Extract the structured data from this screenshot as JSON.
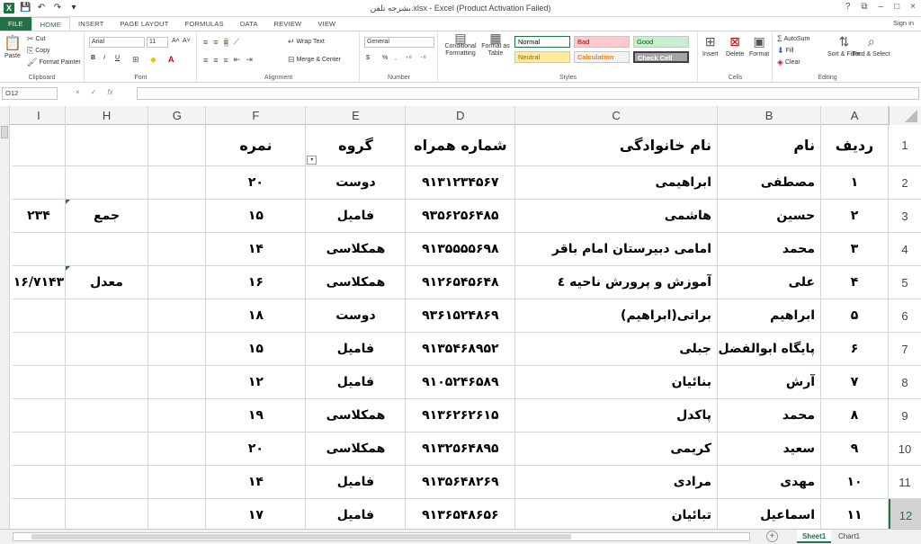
{
  "window": {
    "title": "بشرجه تلفن.xlsx - Excel (Product Activation Failed)",
    "controls": [
      "?",
      "⧉",
      "–",
      "□",
      "×"
    ]
  },
  "tabs": [
    "FILE",
    "HOME",
    "INSERT",
    "PAGE LAYOUT",
    "FORMULAS",
    "DATA",
    "REVIEW",
    "VIEW"
  ],
  "active_tab": "HOME",
  "signin": "Sign in",
  "ribbon": {
    "clipboard": {
      "label": "Clipboard",
      "paste": "Paste",
      "cut": "Cut",
      "copy": "Copy",
      "format_painter": "Format Painter"
    },
    "font": {
      "label": "Font",
      "name": "Arial",
      "size": "11",
      "bold": "B",
      "italic": "I",
      "underline": "U"
    },
    "alignment": {
      "label": "Alignment",
      "wrap_text": "Wrap Text",
      "merge_center": "Merge & Center"
    },
    "number": {
      "label": "Number",
      "format": "General",
      "currency": "$",
      "percent": "%",
      "comma": ","
    },
    "styles": {
      "label": "Styles",
      "conditional_formatting": "Conditional Formatting",
      "format_as_table": "Format as Table",
      "items": [
        {
          "name": "Normal",
          "bg": "#ffffff",
          "fg": "#000000"
        },
        {
          "name": "Bad",
          "bg": "#ffc7ce",
          "fg": "#9c0006"
        },
        {
          "name": "Good",
          "bg": "#c6efce",
          "fg": "#006100"
        },
        {
          "name": "Neutral",
          "bg": "#ffeb9c",
          "fg": "#9c6500"
        },
        {
          "name": "Calculation",
          "bg": "#f2f2f2",
          "fg": "#fa7d00"
        },
        {
          "name": "Check Cell",
          "bg": "#a5a5a5",
          "fg": "#ffffff"
        }
      ]
    },
    "cells": {
      "label": "Cells",
      "insert": "Insert",
      "delete": "Delete",
      "format": "Format"
    },
    "editing": {
      "label": "Editing",
      "autosum": "AutoSum",
      "fill": "Fill",
      "clear": "Clear",
      "sort_filter": "Sort & Filter",
      "find_select": "Find & Select"
    }
  },
  "formula_bar": {
    "name_box": "O12",
    "cancel": "×",
    "enter": "✓",
    "fx": "fx",
    "value": ""
  },
  "columns": [
    "I",
    "H",
    "G",
    "F",
    "E",
    "D",
    "C",
    "B",
    "A"
  ],
  "row_numbers": [
    "1",
    "2",
    "3",
    "4",
    "5",
    "6",
    "7",
    "8",
    "9",
    "10",
    "11",
    "12"
  ],
  "selected_row": "12",
  "table": {
    "headers": {
      "A": "ردیف",
      "B": "نام",
      "C": "نام خانوادگی",
      "D": "شماره همراه",
      "E": "گروه",
      "F": "نمره"
    },
    "rows": [
      {
        "A": "۱",
        "B": "مصطفی",
        "C": "ابراهیمی",
        "D": "۹۱۳۱۲۳۴۵۶۷",
        "E": "دوست",
        "F": "۲۰",
        "H": "",
        "I": ""
      },
      {
        "A": "۲",
        "B": "حسین",
        "C": "هاشمی",
        "D": "۹۳۵۶۲۵۶۴۸۵",
        "E": "فامیل",
        "F": "۱۵",
        "H": "جمع",
        "I": "۲۳۴"
      },
      {
        "A": "۳",
        "B": "محمد",
        "C": "امامی دبیرستان امام باقر",
        "D": "۹۱۳۵۵۵۵۶۹۸",
        "E": "همکلاسی",
        "F": "۱۴",
        "H": "",
        "I": ""
      },
      {
        "A": "۴",
        "B": "علی",
        "C": "آموزش و پرورش ناحیه ٤",
        "D": "۹۱۲۶۵۴۵۶۴۸",
        "E": "همکلاسی",
        "F": "۱۶",
        "H": "معدل",
        "I": "۱۶/۷۱۴۳"
      },
      {
        "A": "۵",
        "B": "ابراهیم",
        "C": "براتی(ابراهیم)",
        "D": "۹۳۶۱۵۲۴۸۶۹",
        "E": "دوست",
        "F": "۱۸",
        "H": "",
        "I": ""
      },
      {
        "A": "۶",
        "B": "پایگاه ابوالفضل",
        "C": "جبلی",
        "D": "۹۱۳۵۴۶۸۹۵۲",
        "E": "فامیل",
        "F": "۱۵",
        "H": "",
        "I": ""
      },
      {
        "A": "۷",
        "B": "آرش",
        "C": "بنائیان",
        "D": "۹۱۰۵۲۴۶۵۸۹",
        "E": "فامیل",
        "F": "۱۲",
        "H": "",
        "I": ""
      },
      {
        "A": "۸",
        "B": "محمد",
        "C": "پاکدل",
        "D": "۹۱۳۶۲۶۲۶۱۵",
        "E": "همکلاسی",
        "F": "۱۹",
        "H": "",
        "I": ""
      },
      {
        "A": "۹",
        "B": "سعید",
        "C": "کریمی",
        "D": "۹۱۳۲۵۶۴۸۹۵",
        "E": "همکلاسی",
        "F": "۲۰",
        "H": "",
        "I": ""
      },
      {
        "A": "۱۰",
        "B": "مهدی",
        "C": "مرادی",
        "D": "۹۱۳۵۶۴۸۲۶۹",
        "E": "فامیل",
        "F": "۱۴",
        "H": "",
        "I": ""
      },
      {
        "A": "۱۱",
        "B": "اسماعیل",
        "C": "تبائیان",
        "D": "۹۱۳۶۵۴۸۶۵۶",
        "E": "فامیل",
        "F": "۱۷",
        "H": "",
        "I": ""
      }
    ]
  },
  "sheets": [
    "Sheet1",
    "Chart1"
  ],
  "active_sheet": "Sheet1",
  "colors": {
    "excel_green": "#217346",
    "header_bg": "#f3f3f3",
    "gridline": "#d5d5d5"
  }
}
